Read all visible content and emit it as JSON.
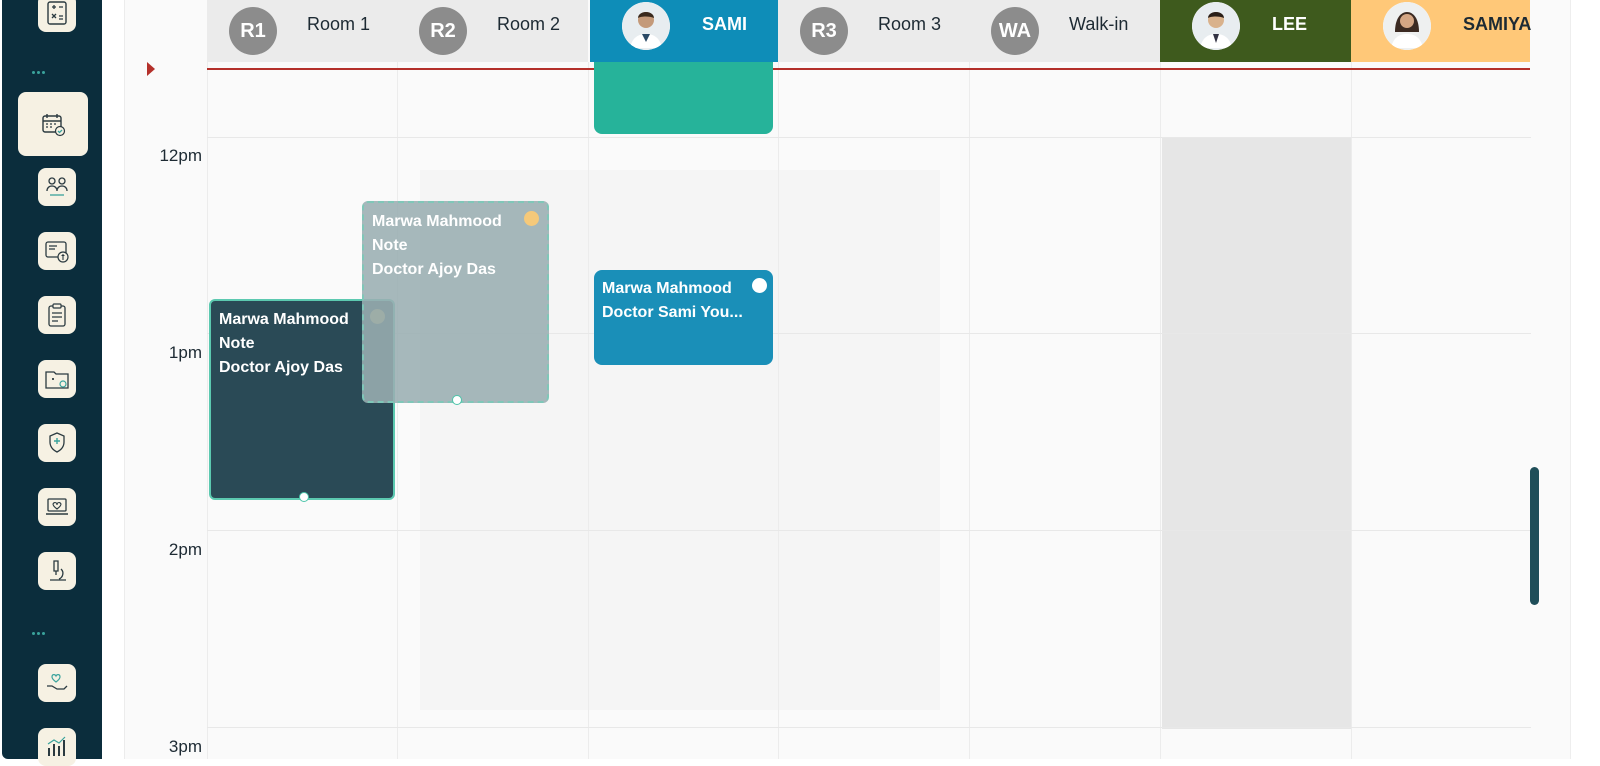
{
  "sidebar": {
    "items": [
      {
        "icon": "calculator-icon"
      },
      {
        "icon": "calendar-check-icon",
        "active": true
      },
      {
        "icon": "doctor-patient-icon"
      },
      {
        "icon": "billing-card-icon"
      },
      {
        "icon": "clipboard-icon"
      },
      {
        "icon": "medical-folder-icon"
      },
      {
        "icon": "health-shield-hands-icon"
      },
      {
        "icon": "heart-monitor-laptop-icon"
      },
      {
        "icon": "microscope-icon"
      },
      {
        "icon": "hand-care-icon"
      },
      {
        "icon": "analytics-chart-icon"
      }
    ]
  },
  "columns": [
    {
      "badge": "R1",
      "name": "Room 1",
      "type": "room"
    },
    {
      "badge": "R2",
      "name": "Room 2",
      "type": "room"
    },
    {
      "badge": "",
      "name": "SAMI",
      "type": "doctor",
      "color": "#0e8db8"
    },
    {
      "badge": "R3",
      "name": "Room 3",
      "type": "room"
    },
    {
      "badge": "WA",
      "name": "Walk-in",
      "type": "room"
    },
    {
      "badge": "",
      "name": "LEE",
      "type": "doctor",
      "color": "#3e5a1d"
    },
    {
      "badge": "",
      "name": "SAMIYA",
      "type": "doctor",
      "color": "#ffc878"
    }
  ],
  "time_labels": [
    "12pm",
    "1pm",
    "2pm",
    "3pm"
  ],
  "appointments": [
    {
      "id": "a1",
      "patient": "Marwa Mahmood",
      "note": "Note",
      "doctor": "Doctor Ajoy Das",
      "color": "#2a4a56",
      "dot": "#b6a35a"
    },
    {
      "id": "a2",
      "patient": "Marwa Mahmood",
      "note": "Note",
      "doctor": "Doctor Ajoy Das",
      "color": "#9aaeb2",
      "dot": "#f5c97a"
    },
    {
      "id": "a3",
      "patient": "Marwa Mahmood",
      "doctor": "Doctor Sami You...",
      "color": "#1a8fb8",
      "dot": "#ffffff"
    },
    {
      "id": "a4",
      "color": "#26b39a"
    }
  ],
  "colors": {
    "sidebar_bg": "#0b2d3c",
    "now_line": "#b4302a",
    "header_bg": "#ebebeb",
    "badge_bg": "#8c8c8c"
  }
}
